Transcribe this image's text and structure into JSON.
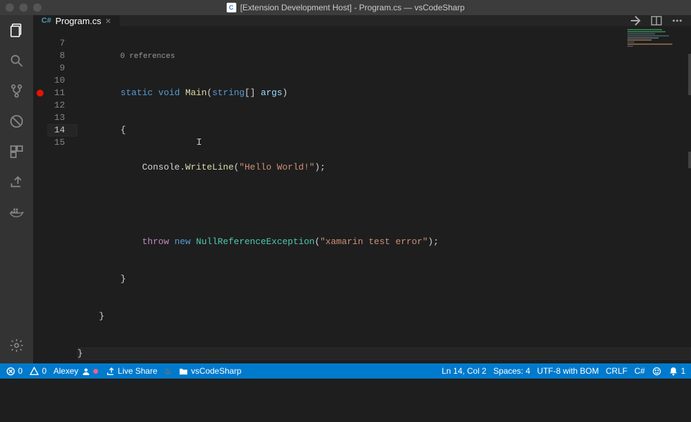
{
  "titlebar": {
    "title": "[Extension Development Host] - Program.cs — vsCodeSharp"
  },
  "tab": {
    "filename": "Program.cs",
    "close_glyph": "×"
  },
  "codelens": "0 references",
  "lines": {
    "7": {
      "num": "7"
    },
    "8": {
      "num": "8"
    },
    "9": {
      "num": "9"
    },
    "10": {
      "num": "10"
    },
    "11": {
      "num": "11"
    },
    "12": {
      "num": "12"
    },
    "13": {
      "num": "13"
    },
    "14": {
      "num": "14"
    },
    "15": {
      "num": "15"
    }
  },
  "code": {
    "l7_static": "static",
    "l7_void": "void",
    "l7_main": "Main",
    "l7_p1": "(",
    "l7_string": "string",
    "l7_brk": "[] ",
    "l7_args": "args",
    "l7_p2": ")",
    "l8": "{",
    "l9_console": "Console",
    "l9_dot": ".",
    "l9_wl": "WriteLine",
    "l9_p1": "(",
    "l9_str": "\"Hello World!\"",
    "l9_p2": ");",
    "l11_throw": "throw",
    "l11_new": "new",
    "l11_type": "NullReferenceException",
    "l11_p1": "(",
    "l11_str": "\"xamarin test error\"",
    "l11_p2": ");",
    "l12": "}",
    "l13": "}",
    "l14": "}"
  },
  "statusbar": {
    "errors": "0",
    "warnings": "0",
    "user": "Alexey",
    "liveshare": "Live Share",
    "folder": "vsCodeSharp",
    "lncol": "Ln 14, Col 2",
    "spaces": "Spaces: 4",
    "encoding": "UTF-8 with BOM",
    "eol": "CRLF",
    "lang": "C#",
    "bell": "1"
  },
  "icons": {
    "explorer": "explorer",
    "search": "search",
    "scm": "source-control",
    "debug": "debug",
    "extensions": "extensions",
    "share": "share",
    "docker": "docker",
    "gear": "settings"
  }
}
